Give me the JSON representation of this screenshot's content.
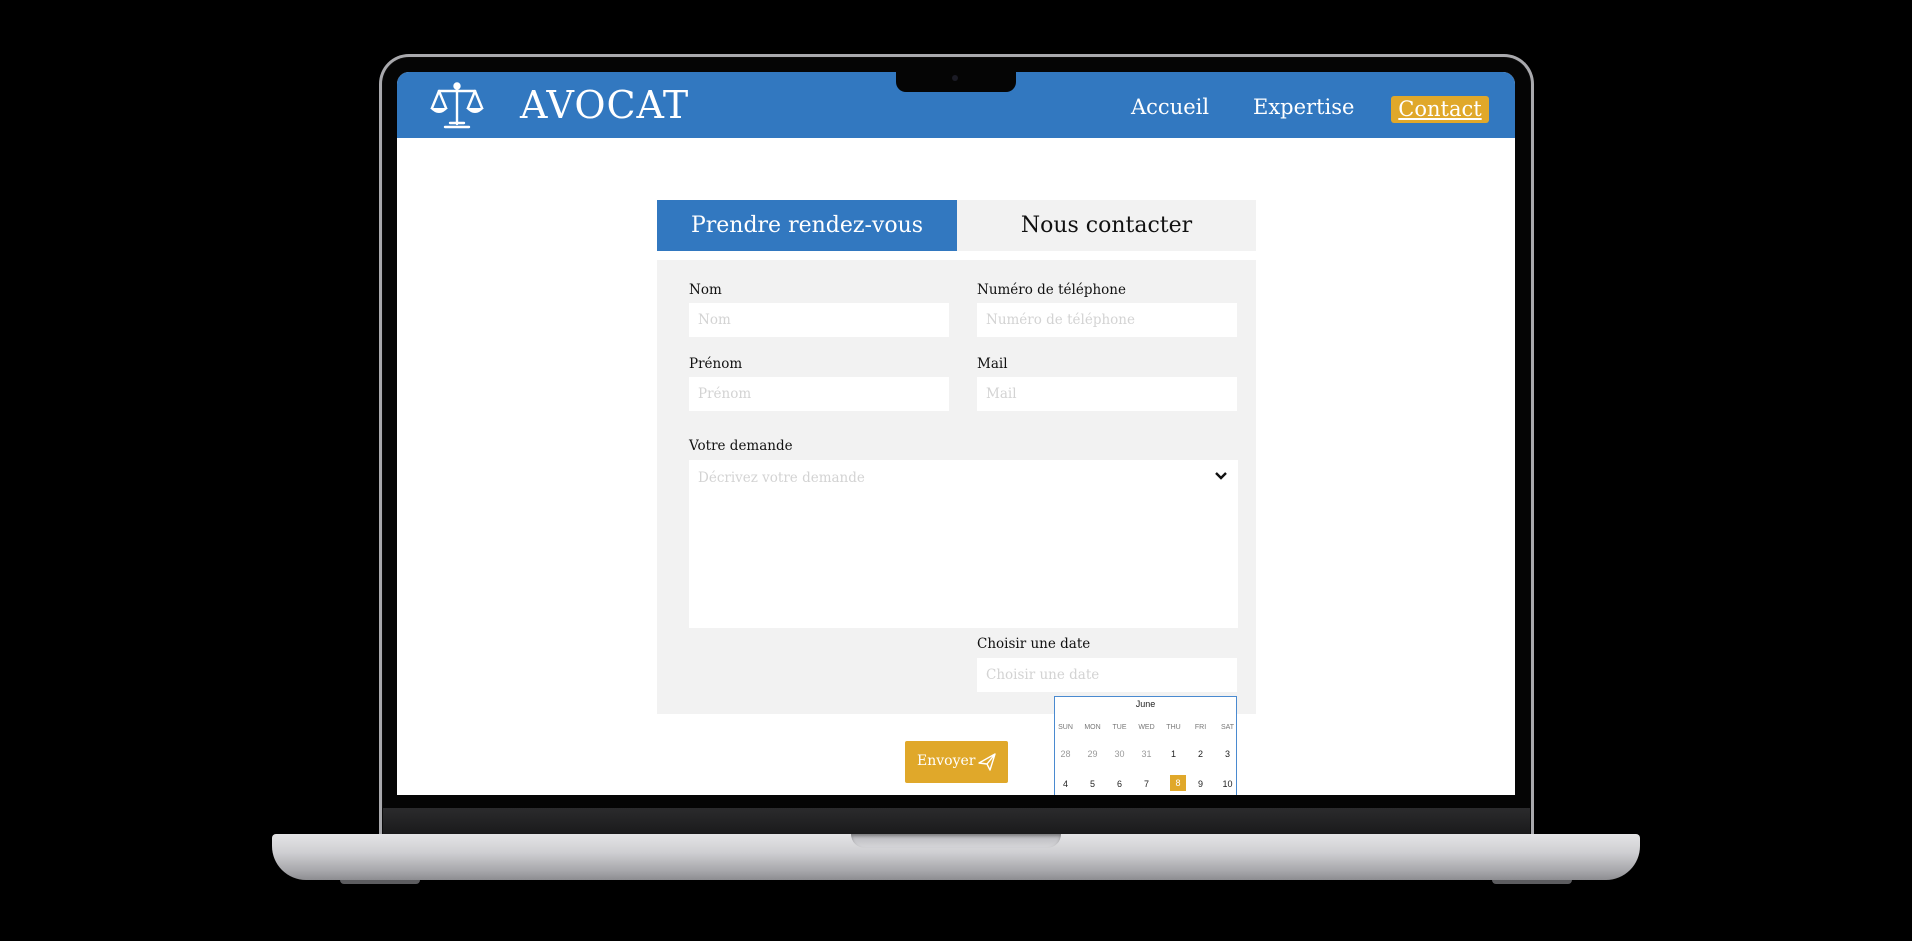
{
  "header": {
    "brand": "AVOCAT",
    "nav": {
      "home": "Accueil",
      "expertise": "Expertise",
      "contact": "Contact"
    },
    "colors": {
      "primary": "#3278c0",
      "accent": "#e0a82a"
    }
  },
  "tabs": {
    "appointment": "Prendre rendez-vous",
    "contact": "Nous contacter"
  },
  "form": {
    "last_name": {
      "label": "Nom",
      "placeholder": "Nom",
      "value": ""
    },
    "phone": {
      "label": "Numéro de téléphone",
      "placeholder": "Numéro de téléphone",
      "value": ""
    },
    "first_name": {
      "label": "Prénom",
      "placeholder": "Prénom",
      "value": ""
    },
    "email": {
      "label": "Mail",
      "placeholder": "Mail",
      "value": ""
    },
    "request": {
      "label": "Votre demande",
      "placeholder": "Décrivez votre demande",
      "value": ""
    },
    "date": {
      "label": "Choisir une date",
      "placeholder": "Choisir une date",
      "value": ""
    },
    "submit_label": "Envoyer"
  },
  "calendar": {
    "month": "June",
    "weekdays": [
      "SUN",
      "MON",
      "TUE",
      "WED",
      "THU",
      "FRI",
      "SAT"
    ],
    "week1": [
      "28",
      "29",
      "30",
      "31",
      "1",
      "2",
      "3"
    ],
    "week2": [
      "4",
      "5",
      "6",
      "7",
      "8",
      "9",
      "10"
    ],
    "selected_day": "8"
  }
}
